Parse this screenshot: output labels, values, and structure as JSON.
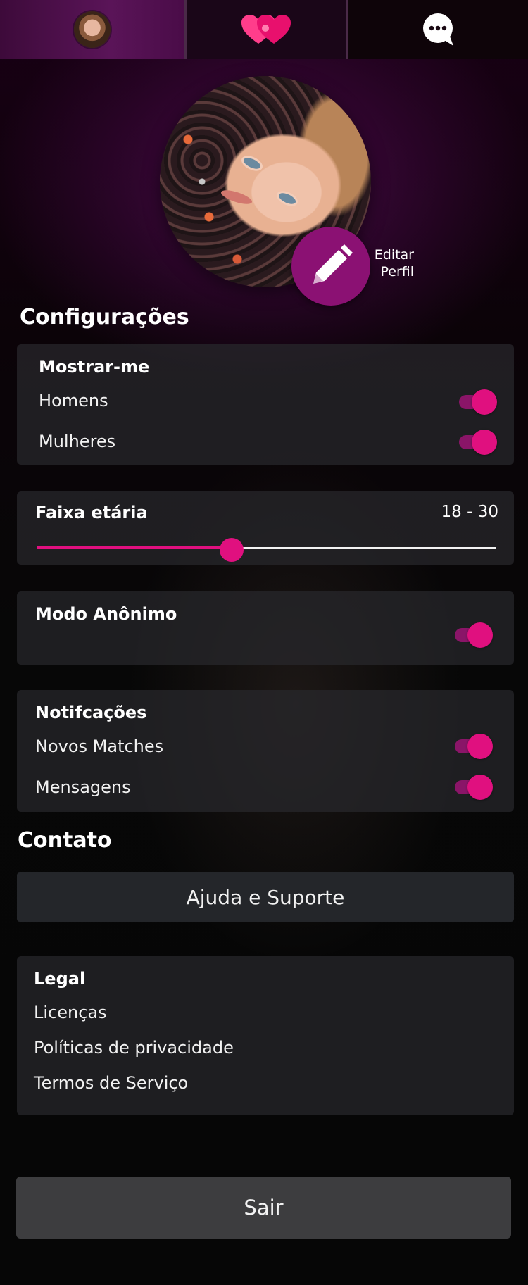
{
  "tabs": [
    {
      "name": "profile-tab",
      "icon": "avatar-icon"
    },
    {
      "name": "matches-tab",
      "icon": "hearts-icon"
    },
    {
      "name": "chat-tab",
      "icon": "chat-bubble-icon"
    }
  ],
  "profile": {
    "edit_label_line1": "Editar",
    "edit_label_line2": "Perfil",
    "edit_icon": "pencil-icon"
  },
  "settings": {
    "title": "Configurações",
    "show_me": {
      "title": "Mostrar-me",
      "options": [
        {
          "label": "Homens",
          "on": true
        },
        {
          "label": "Mulheres",
          "on": true
        }
      ]
    },
    "age_range": {
      "title": "Faixa etária",
      "value_text": "18 - 30",
      "slider_fraction": 0.425
    },
    "anonymous": {
      "title": "Modo Anônimo",
      "on": true
    },
    "notifications": {
      "title": "Notifcações",
      "options": [
        {
          "label": "Novos Matches",
          "on": true
        },
        {
          "label": "Mensagens",
          "on": true
        }
      ]
    }
  },
  "contact": {
    "title": "Contato",
    "help_button": "Ajuda e Suporte"
  },
  "legal": {
    "title": "Legal",
    "items": [
      "Licenças",
      "Políticas de privacidade",
      "Termos de Serviço"
    ]
  },
  "logout_button": "Sair",
  "colors": {
    "accent": "#e0107f",
    "accent_dark": "#8b1173",
    "card": "#2a2a2e"
  }
}
